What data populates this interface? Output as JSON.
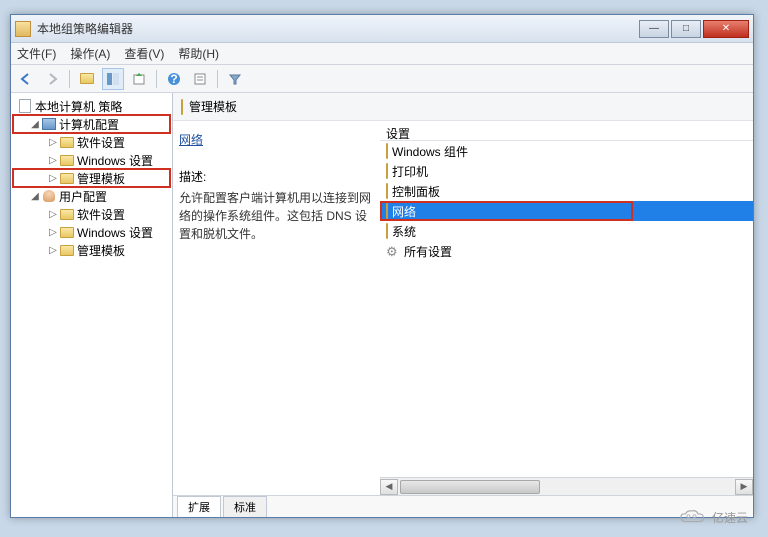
{
  "window": {
    "title": "本地组策略编辑器"
  },
  "menu": {
    "file": "文件(F)",
    "action": "操作(A)",
    "view": "查看(V)",
    "help": "帮助(H)"
  },
  "tree": {
    "root": "本地计算机 策略",
    "computer": "计算机配置",
    "software1": "软件设置",
    "windows1": "Windows 设置",
    "admin1": "管理模板",
    "user": "用户配置",
    "software2": "软件设置",
    "windows2": "Windows 设置",
    "admin2": "管理模板"
  },
  "header": {
    "title": "管理模板"
  },
  "leftPane": {
    "heading": "网络",
    "descLabel": "描述:",
    "descText": "允许配置客户端计算机用以连接到网络的操作系统组件。这包括 DNS 设置和脱机文件。"
  },
  "rightPane": {
    "colHead": "设置",
    "items": [
      {
        "label": "Windows 组件",
        "icon": "folder"
      },
      {
        "label": "打印机",
        "icon": "folder"
      },
      {
        "label": "控制面板",
        "icon": "folder"
      },
      {
        "label": "网络",
        "icon": "folder",
        "selected": true
      },
      {
        "label": "系统",
        "icon": "folder"
      },
      {
        "label": "所有设置",
        "icon": "gear"
      }
    ]
  },
  "tabs": {
    "extended": "扩展",
    "standard": "标准"
  },
  "watermark": "亿速云"
}
